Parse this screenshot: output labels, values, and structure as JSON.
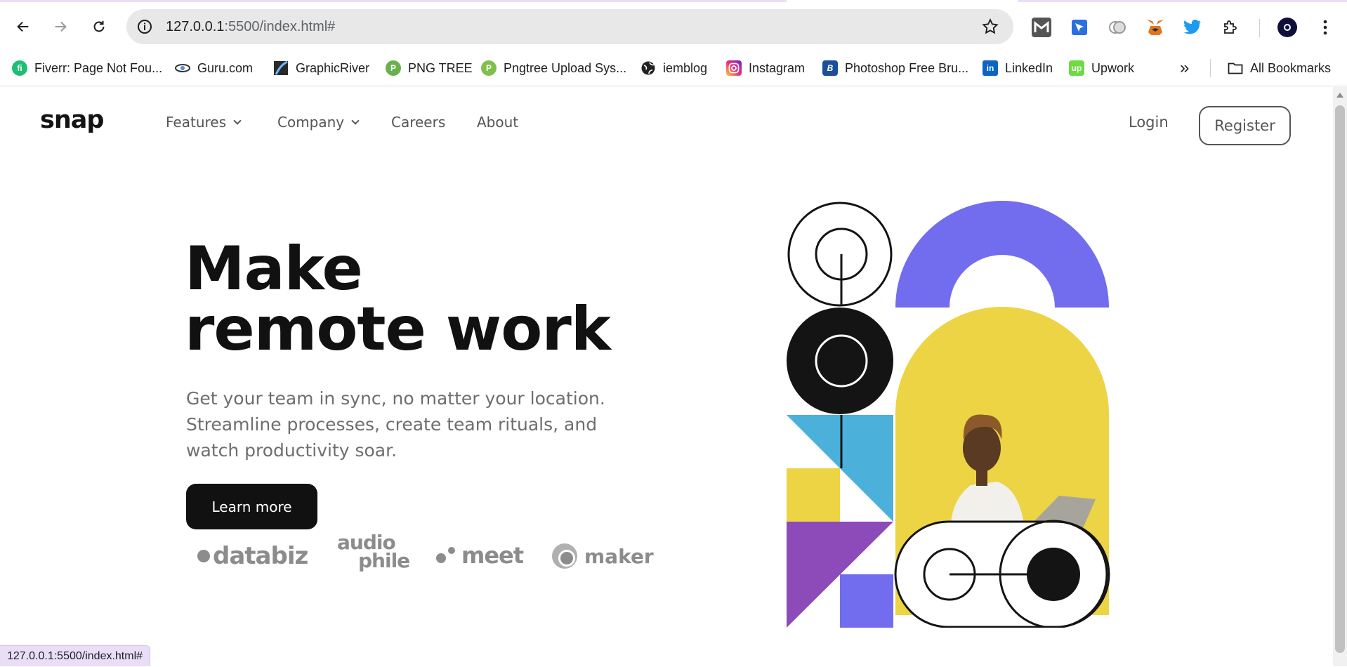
{
  "browser": {
    "url_host": "127.0.0.1",
    "url_rest": ":5500/index.html#",
    "status_url": "127.0.0.1:5500/index.html#",
    "bookmarks": [
      {
        "label": "Fiverr: Page Not Fou...",
        "icon": "fiverr-icon",
        "color": "#1dbf73"
      },
      {
        "label": "Guru.com",
        "icon": "guru-icon",
        "color": "#333333"
      },
      {
        "label": "GraphicRiver",
        "icon": "graphicriver-icon",
        "color": "#2a6db5"
      },
      {
        "label": "PNG TREE",
        "icon": "pngtree-icon",
        "color": "#6ab04c"
      },
      {
        "label": "Pngtree Upload Sys...",
        "icon": "pngtree-upload-icon",
        "color": "#7fc04a"
      },
      {
        "label": "iemblog",
        "icon": "globe-icon",
        "color": "#222222"
      },
      {
        "label": "Instagram",
        "icon": "instagram-icon",
        "color": "#d6249f"
      },
      {
        "label": "Photoshop Free Bru...",
        "icon": "photoshop-brushes-icon",
        "color": "#1b4f9c"
      },
      {
        "label": "LinkedIn",
        "icon": "linkedin-icon",
        "color": "#0a66c2"
      },
      {
        "label": "Upwork",
        "icon": "upwork-icon",
        "color": "#6fda44"
      }
    ],
    "all_bookmarks": "All Bookmarks",
    "overflow_label": "»"
  },
  "site": {
    "logo": "snap",
    "nav": [
      {
        "label": "Features",
        "dropdown": true
      },
      {
        "label": "Company",
        "dropdown": true
      },
      {
        "label": "Careers",
        "dropdown": false
      },
      {
        "label": "About",
        "dropdown": false
      }
    ],
    "login": "Login",
    "register": "Register",
    "hero": {
      "title_line1": "Make",
      "title_line2": "remote work",
      "sub_line1": "Get your team in sync, no matter your location.",
      "sub_line2": "Streamline processes, create team rituals, and",
      "sub_line3": "watch productivity soar.",
      "cta": "Learn more"
    },
    "clients": {
      "databiz": "databiz",
      "audiophile_top": "audio",
      "audiophile_bottom": "phile",
      "meet": "meet",
      "maker": "maker"
    },
    "colors": {
      "purple": "#726cee",
      "blue": "#4bb1da",
      "yellow": "#ecd444",
      "violet": "#8d4bb9",
      "ink": "#141414"
    }
  }
}
